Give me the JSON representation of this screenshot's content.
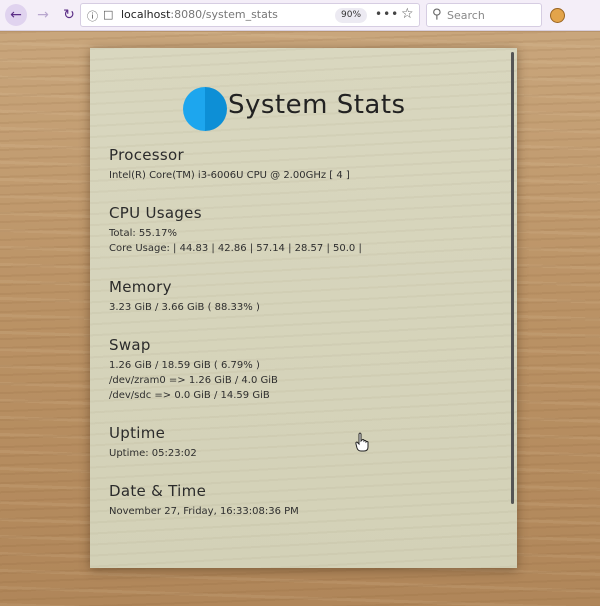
{
  "browser": {
    "url_host": "localhost",
    "url_rest": ":8080/system_stats",
    "zoom": "90%",
    "page_actions": "•••",
    "search_placeholder": "Search"
  },
  "page": {
    "title": "System Stats",
    "sections": {
      "processor": {
        "title": "Processor",
        "lines": [
          "Intel(R) Core(TM) i3-6006U CPU @ 2.00GHz [ 4 ]"
        ]
      },
      "cpu": {
        "title": "CPU Usages",
        "lines": [
          "Total: 55.17%",
          "Core Usage: | 44.83 | 42.86 | 57.14 | 28.57 | 50.0 |"
        ]
      },
      "memory": {
        "title": "Memory",
        "lines": [
          "3.23 GiB / 3.66 GiB ( 88.33% )"
        ]
      },
      "swap": {
        "title": "Swap",
        "lines": [
          "1.26 GiB / 18.59 GiB ( 6.79% )",
          "/dev/zram0 => 1.26 GiB / 4.0 GiB",
          "/dev/sdc => 0.0 GiB / 14.59 GiB"
        ]
      },
      "uptime": {
        "title": "Uptime",
        "lines": [
          "Uptime: 05:23:02"
        ]
      },
      "datetime": {
        "title": "Date & Time",
        "lines": [
          "November 27, Friday, 16:33:08:36 PM"
        ]
      }
    }
  }
}
